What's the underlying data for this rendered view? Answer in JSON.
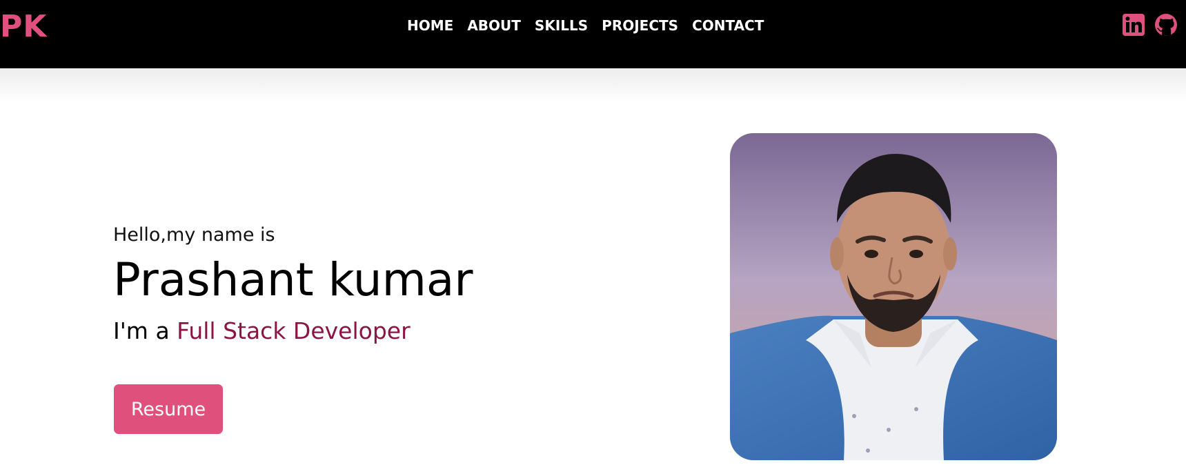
{
  "brand": {
    "logo_text": "PK",
    "accent_color": "#df507c"
  },
  "nav": {
    "items": [
      {
        "label": "HOME"
      },
      {
        "label": "ABOUT"
      },
      {
        "label": "SKILLS"
      },
      {
        "label": "PROJECTS"
      },
      {
        "label": "CONTACT"
      }
    ],
    "social": [
      {
        "icon": "linkedin-icon"
      },
      {
        "icon": "github-icon"
      }
    ]
  },
  "hero": {
    "greeting": "Hello,my name is",
    "name": "Prashant kumar",
    "role_prefix": "I'm a ",
    "role_highlight": "Full Stack Developer",
    "role_highlight_color": "#8c1345",
    "resume_label": "Resume",
    "photo": "profile-photo"
  }
}
